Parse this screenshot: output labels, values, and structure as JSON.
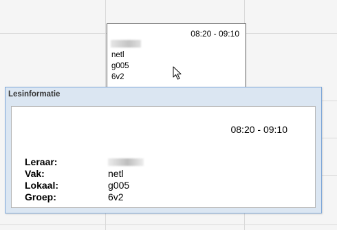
{
  "lesson_card": {
    "time": "08:20 - 09:10",
    "subject": "netl",
    "room": "g005",
    "group": "6v2"
  },
  "popup": {
    "title": "Lesinformatie",
    "time": "08:20 - 09:10",
    "rows": [
      {
        "label": "Leraar:",
        "value": ""
      },
      {
        "label": "Vak:",
        "value": "netl"
      },
      {
        "label": "Lokaal:",
        "value": "g005"
      },
      {
        "label": "Groep:",
        "value": "6v2"
      }
    ]
  },
  "icons": {
    "cursor": "arrow-cursor-icon",
    "teacher_redacted": "redacted-name"
  },
  "colors": {
    "popup_header_bg": "#dbe6f2",
    "popup_border": "#7ea7d8",
    "grid_line": "#d9d9d9"
  }
}
